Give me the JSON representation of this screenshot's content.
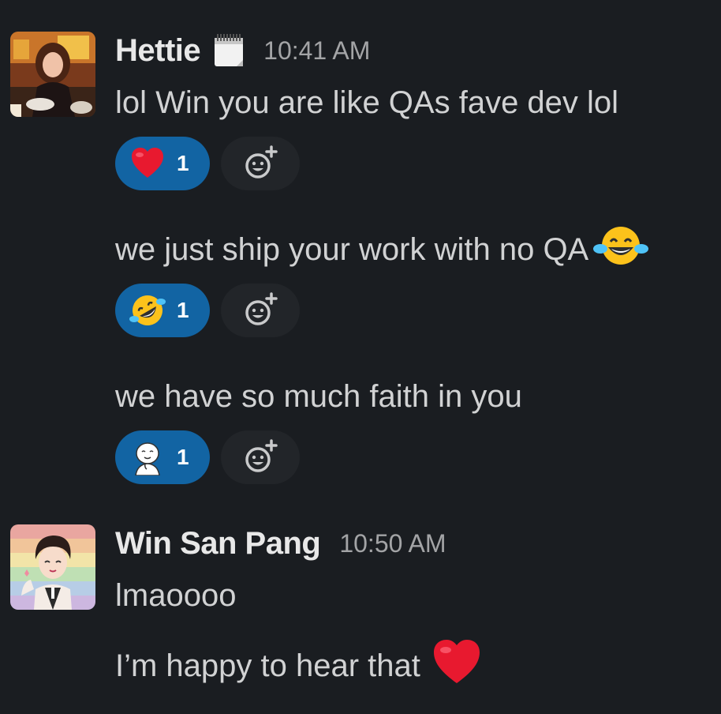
{
  "messages": [
    {
      "author": "Hettie",
      "time": "10:41 AM",
      "avatar_icon": "avatar-photo",
      "status_icon": "spiral-calendar-icon",
      "lines": [
        {
          "text": "lol Win you are like QAs fave dev lol",
          "reaction": {
            "emoji": "heart-emoji",
            "count": "1"
          }
        },
        {
          "text": "we just ship your work with no QA",
          "trailing_emoji": "joy-emoji",
          "reaction": {
            "emoji": "rofl-emoji",
            "count": "1"
          }
        },
        {
          "text": "we have so much faith in you",
          "reaction": {
            "emoji": "meme-face-emoji",
            "count": "1"
          }
        }
      ]
    },
    {
      "author": "Win San Pang",
      "time": "10:50 AM",
      "avatar_icon": "avatar-illustration",
      "lines": [
        {
          "text": "lmaoooo"
        },
        {
          "text": "I’m happy to hear that",
          "trailing_emoji": "heart-emoji"
        }
      ]
    }
  ],
  "colors": {
    "background": "#1a1d21",
    "reaction_active": "#1264a3",
    "add_reaction_bg": "#222529",
    "text": "#d1d2d3",
    "timestamp": "#a3a4a6"
  }
}
